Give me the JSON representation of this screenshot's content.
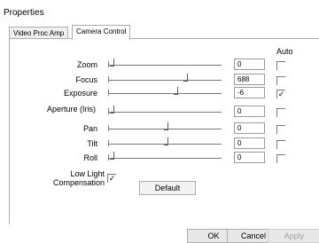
{
  "window": {
    "title": "Properties"
  },
  "tabs": [
    {
      "label": "Video Proc Amp",
      "active": false
    },
    {
      "label": "Camera Control",
      "active": true
    }
  ],
  "auto_header": "Auto",
  "controls": [
    {
      "label": "Zoom",
      "value": "0",
      "slider_pos": 0.0,
      "auto": false
    },
    {
      "label": "Focus",
      "value": "688",
      "slider_pos": 0.68,
      "auto": false
    },
    {
      "label": "Exposure",
      "value": "-6",
      "slider_pos": 0.59,
      "auto": true
    },
    {
      "label": "Aperture (Iris)",
      "value": "0",
      "slider_pos": 0.0,
      "auto": false
    },
    {
      "label": "Pan",
      "value": "0",
      "slider_pos": 0.5,
      "auto": false
    },
    {
      "label": "Tilt",
      "value": "0",
      "slider_pos": 0.5,
      "auto": false
    },
    {
      "label": "Roll",
      "value": "0",
      "slider_pos": 0.0,
      "auto": false
    }
  ],
  "low_light": {
    "label": "Low Light Compensation",
    "checked": true
  },
  "buttons": {
    "default": "Default",
    "ok": "OK",
    "cancel": "Cancel",
    "apply": "Apply"
  },
  "check_glyph": "✓"
}
